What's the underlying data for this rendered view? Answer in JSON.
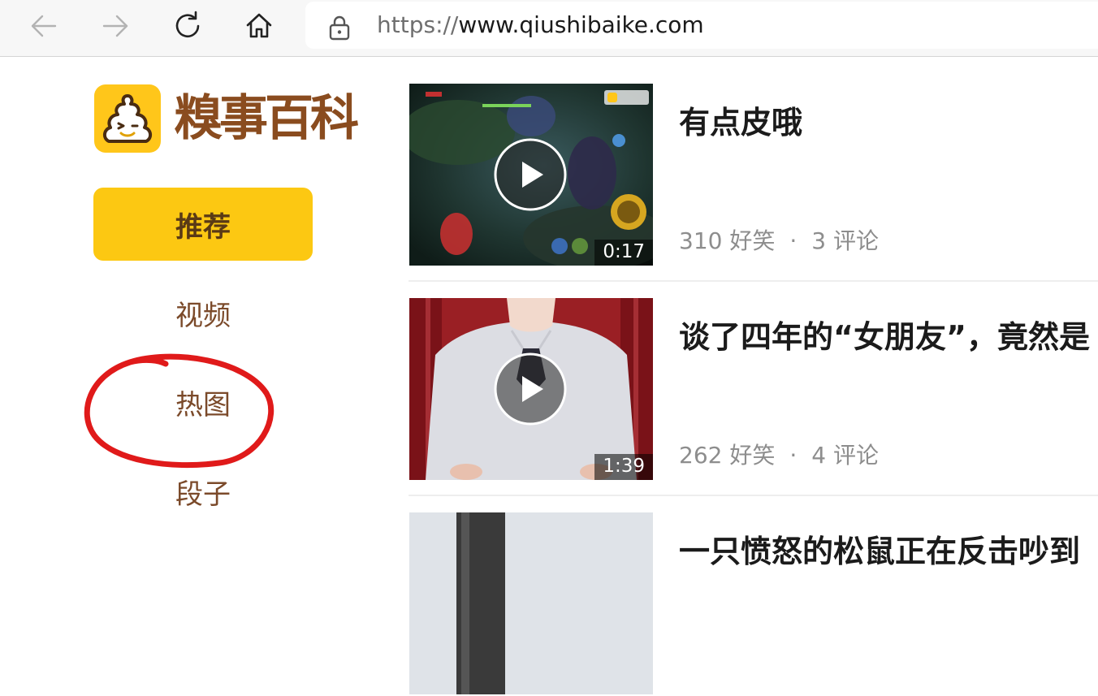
{
  "browser": {
    "url_scheme": "https://",
    "url_host": "www.qiushibaike.com"
  },
  "sidebar": {
    "logo_text": "糗事百科",
    "nav": [
      {
        "label": "推荐",
        "active": true
      },
      {
        "label": "视频",
        "active": false
      },
      {
        "label": "热图",
        "active": false,
        "annotated": true
      },
      {
        "label": "段子",
        "active": false
      }
    ]
  },
  "feed": [
    {
      "title": "有点皮哦",
      "duration": "0:17",
      "laughs": "310 好笑",
      "comments": "3 评论"
    },
    {
      "title": "谈了四年的“女朋友”，竟然是",
      "duration": "1:39",
      "laughs": "262 好笑",
      "comments": "4 评论"
    },
    {
      "title": "一只愤怒的松鼠正在反击吵到"
    }
  ],
  "colors": {
    "accent": "#fcc812",
    "brand_brown": "#8a4c1f",
    "annotation_red": "#e01a1a"
  }
}
